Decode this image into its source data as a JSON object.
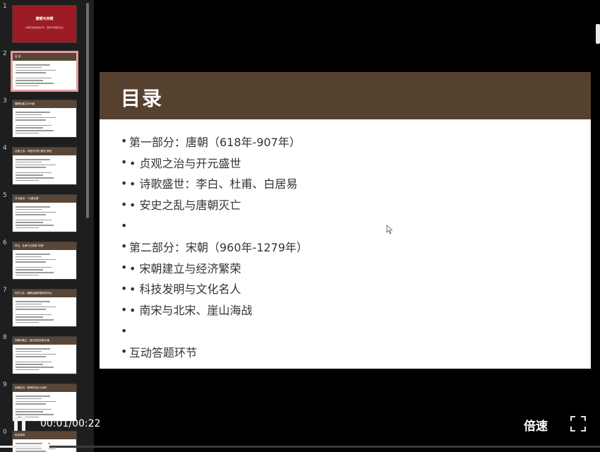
{
  "slide": {
    "title": "目录",
    "bullets": [
      "第一部分：唐朝（618年-907年）",
      "• 贞观之治与开元盛世",
      "• 诗歌盛世：李白、杜甫、白居易",
      "• 安史之乱与唐朝灭亡",
      "",
      "第二部分：宋朝（960年-1279年）",
      "• 宋朝建立与经济繁荣",
      "• 科技发明与文化名人",
      "• 南宋与北宋、崖山海战",
      "",
      "互动答题环节"
    ]
  },
  "thumbnails": [
    {
      "num": "1",
      "title": "唐朝与宋朝",
      "subtitle": "中国历史的辉煌时代：唐朝与宋朝的对比",
      "style": "title"
    },
    {
      "num": "2",
      "title": "目 录",
      "style": "content",
      "selected": true
    },
    {
      "num": "3",
      "title": "唐朝的建立与兴盛",
      "style": "content"
    },
    {
      "num": "4",
      "title": "贞观之治：中国古代的\"盛世\"典范",
      "style": "content"
    },
    {
      "num": "5",
      "title": "开元盛世：\"大唐全盛\"",
      "style": "content"
    },
    {
      "num": "6",
      "title": "李白、杜甫与白居易\"诗歌\"",
      "style": "content"
    },
    {
      "num": "7",
      "title": "安史之乱：唐朝由盛转衰的转折点",
      "style": "content"
    },
    {
      "num": "8",
      "title": "宋朝的建立：重文轻武的新王朝",
      "style": "content"
    },
    {
      "num": "9",
      "title": "宋朝经济：繁荣的商业与城市",
      "style": "content"
    },
    {
      "num": "0",
      "title": "科技发明",
      "style": "content"
    }
  ],
  "player": {
    "time": "00:01/00:22",
    "speed_label": "倍速",
    "progress": 0.075
  }
}
